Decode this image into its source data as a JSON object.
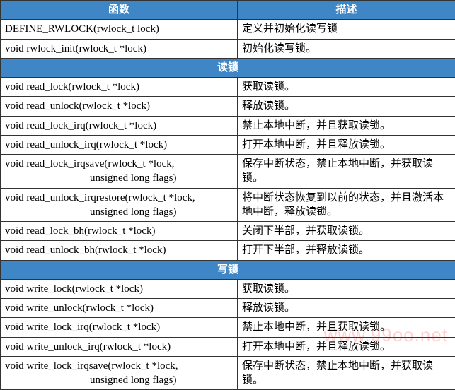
{
  "headers": {
    "func": "函数",
    "desc": "描述"
  },
  "section_read": "读锁",
  "section_write": "写锁",
  "top_rows": [
    {
      "func": "DEFINE_RWLOCK(rwlock_t lock)",
      "desc": "定义并初始化读写锁"
    },
    {
      "func": "void rwlock_init(rwlock_t *lock)",
      "desc": "初始化读写锁。"
    }
  ],
  "read_rows": [
    {
      "func": "void read_lock(rwlock_t *lock)",
      "desc": "获取读锁。"
    },
    {
      "func": "void read_unlock(rwlock_t *lock)",
      "desc": "释放读锁。"
    },
    {
      "func": "void read_lock_irq(rwlock_t *lock)",
      "desc": "禁止本地中断，并且获取读锁。"
    },
    {
      "func": "void read_unlock_irq(rwlock_t *lock)",
      "desc": "打开本地中断，并且释放读锁。"
    },
    {
      "func": "void read_lock_irqsave(rwlock_t *lock,",
      "func2": "unsigned long flags)",
      "desc": "保存中断状态，禁止本地中断，并获取读锁。"
    },
    {
      "func": "void read_unlock_irqrestore(rwlock_t *lock,",
      "func2": "unsigned long flags)",
      "desc": "将中断状态恢复到以前的状态，并且激活本地中断，释放读锁。"
    },
    {
      "func": "void read_lock_bh(rwlock_t *lock)",
      "desc": "关闭下半部，并获取读锁。"
    },
    {
      "func": "void read_unlock_bh(rwlock_t *lock)",
      "desc": "打开下半部，并释放读锁。"
    }
  ],
  "write_rows": [
    {
      "func": "void write_lock(rwlock_t *lock)",
      "desc": "获取读锁。"
    },
    {
      "func": "void write_unlock(rwlock_t *lock)",
      "desc": "释放读锁。"
    },
    {
      "func": "void write_lock_irq(rwlock_t *lock)",
      "desc": "禁止本地中断，并且获取读锁。"
    },
    {
      "func": "void write_unlock_irq(rwlock_t *lock)",
      "desc": "打开本地中断，并且释放读锁。"
    },
    {
      "func": "void write_lock_irqsave(rwlock_t *lock,",
      "func2": "unsigned long flags)",
      "desc": "保存中断状态，禁止本地中断，并获取读锁。"
    }
  ],
  "watermark": "www.99oo.net"
}
